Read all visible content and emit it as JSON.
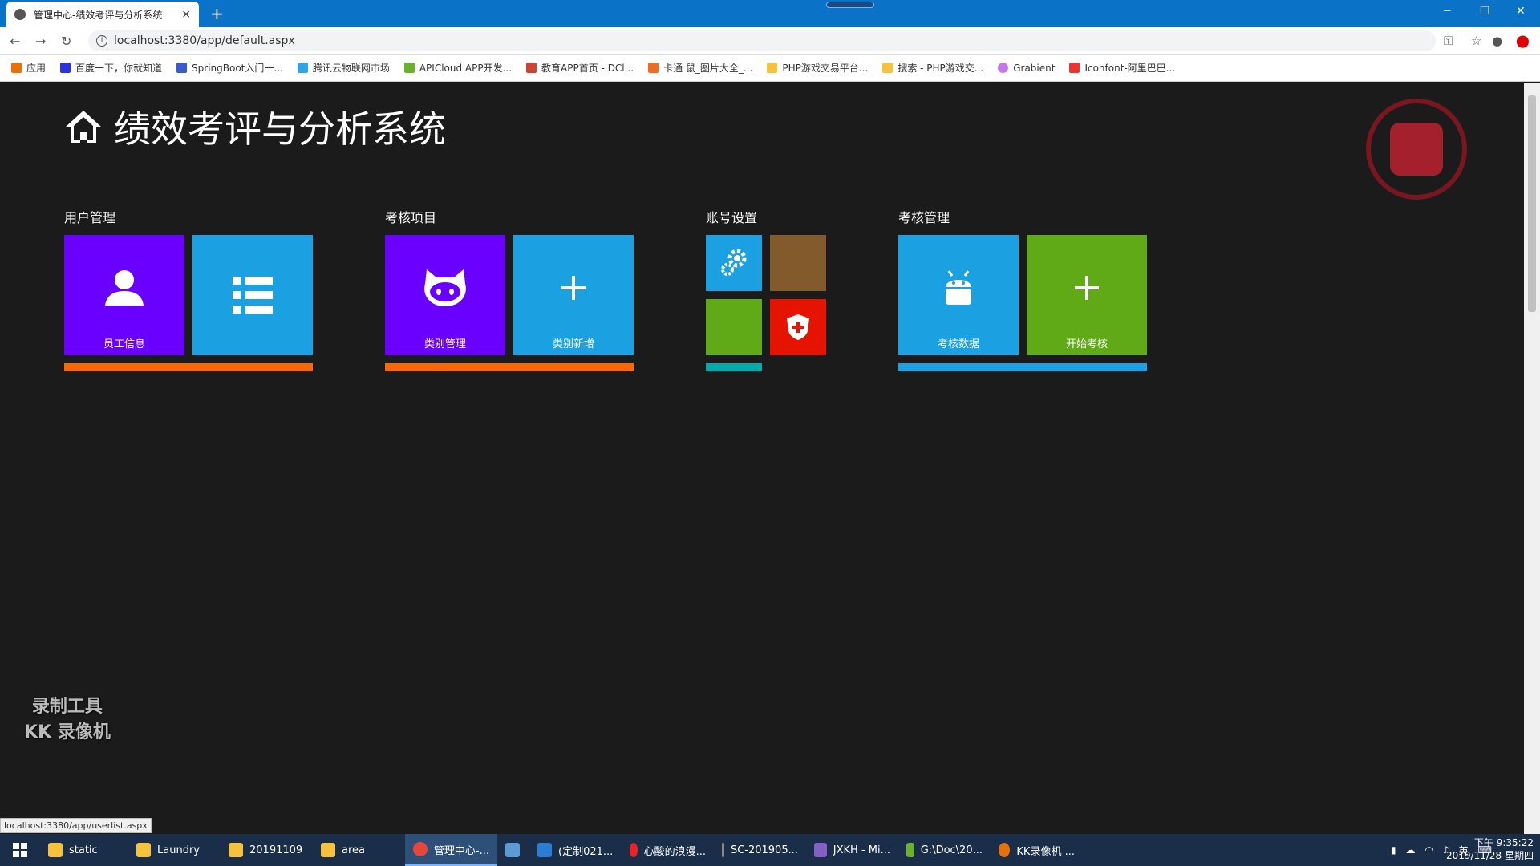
{
  "browser": {
    "tab_title": "管理中心-绩效考评与分析系统",
    "tab_close": "×",
    "new_tab": "+",
    "url": "localhost:3380/app/default.aspx",
    "bookmarks": [
      "应用",
      "百度一下，你就知道",
      "SpringBoot入门一...",
      "腾讯云物联网市场",
      "APICloud APP开发...",
      "教育APP首页 - DCl...",
      "卡通 鼠_图片大全_...",
      "PHP游戏交易平台...",
      "搜索 - PHP游戏交...",
      "Grabient",
      "Iconfont-阿里巴巴..."
    ],
    "status_url": "localhost:3380/app/userlist.aspx"
  },
  "page": {
    "title": "绩效考评与分析系统",
    "groups": [
      {
        "title": "用户管理",
        "tiles": [
          "员工信息",
          ""
        ]
      },
      {
        "title": "考核项目",
        "tiles": [
          "类别管理",
          "类别新增"
        ]
      },
      {
        "title": "账号设置",
        "tiles": []
      },
      {
        "title": "考核管理",
        "tiles": [
          "考核数据",
          "开始考核"
        ]
      }
    ],
    "colors": {
      "purple": "#6a00ff",
      "blue": "#1ba1e2",
      "green": "#60a917",
      "brown": "#825a2c",
      "red": "#e51400",
      "orange": "#fa6800",
      "teal": "#00aba9"
    },
    "watermark_line1": "录制工具",
    "watermark_line2": "KK 录像机"
  },
  "taskbar": {
    "items": [
      "static",
      "Laundry",
      "20191109",
      "area",
      "管理中心-...",
      "",
      "(定制021...",
      "心酸的浪漫...",
      "SC-201905...",
      "JXKH - Mi...",
      "G:\\Doc\\20...",
      "KK录像机 ..."
    ],
    "ime": "英",
    "time": "下午 9:35:22",
    "date": "2019/11/28 星期四"
  }
}
